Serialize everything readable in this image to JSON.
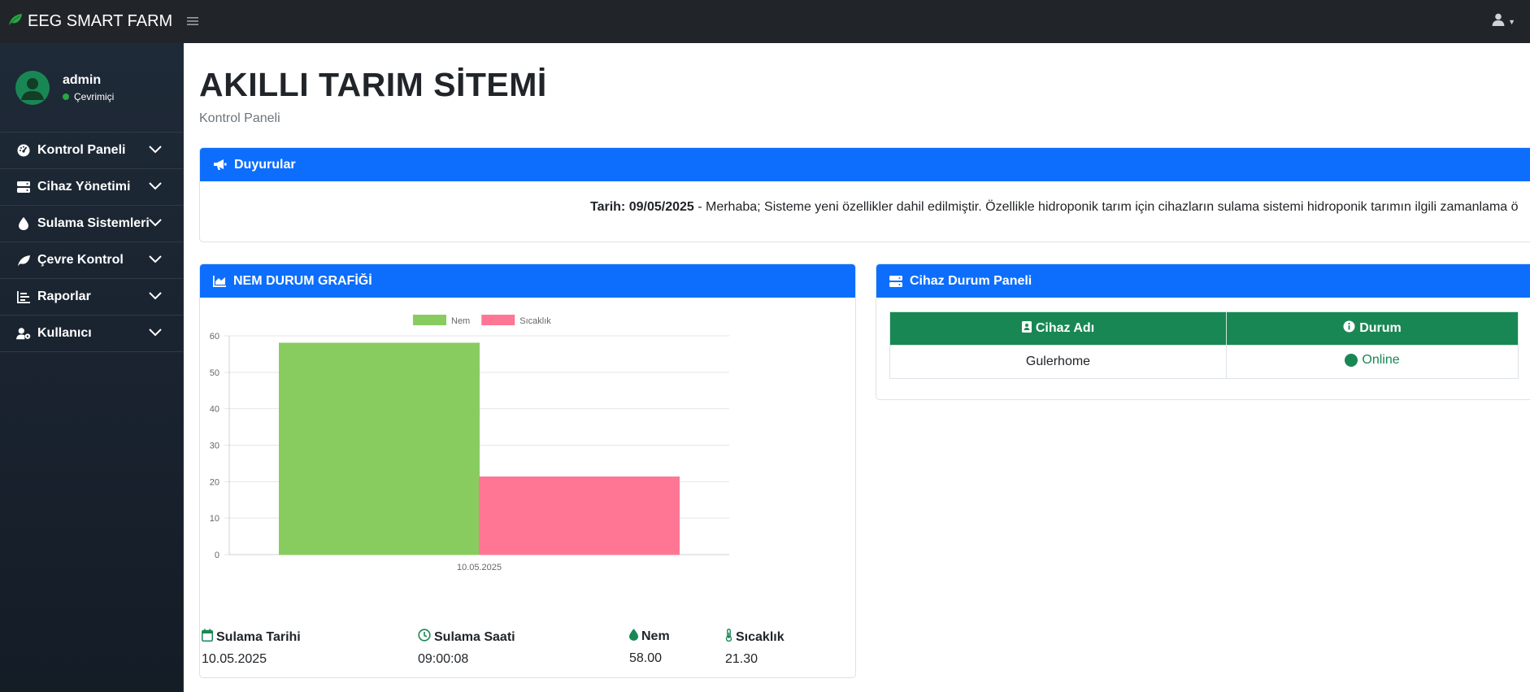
{
  "brand": {
    "title": "EEG SMART FARM",
    "icon": "leaf-icon",
    "color": "#28a745"
  },
  "topbar": {
    "menu_icon": "bars-icon",
    "user_icon": "user-icon"
  },
  "sidebar": {
    "user": {
      "name": "admin",
      "status": "Çevrimiçi"
    },
    "items": [
      {
        "label": "Kontrol Paneli",
        "icon": "tachometer-icon"
      },
      {
        "label": "Cihaz Yönetimi",
        "icon": "server-icon"
      },
      {
        "label": "Sulama Sistemleri",
        "icon": "droplet-icon"
      },
      {
        "label": "Çevre Kontrol",
        "icon": "leaf-icon"
      },
      {
        "label": "Raporlar",
        "icon": "chart-bar-icon"
      },
      {
        "label": "Kullanıcı",
        "icon": "user-cog-icon"
      }
    ]
  },
  "page": {
    "title": "AKILLI TARIM SİTEMİ",
    "subtitle": "Kontrol Paneli"
  },
  "announcements": {
    "header": "Duyurular",
    "date_label": "Tarih: 09/05/2025",
    "text": " - Merhaba; Sisteme yeni özellikler dahil edilmiştir. Özellikle hidroponik tarım için cihazların sulama sistemi hidroponik tarımın ilgili zamanlama ö"
  },
  "chart_card": {
    "header": "NEM DURUM GRAFİĞİ",
    "stats": [
      {
        "label": "Sulama Tarihi",
        "value": "10.05.2025",
        "icon": "calendar-icon"
      },
      {
        "label": "Sulama Saati",
        "value": "09:00:08",
        "icon": "clock-icon"
      },
      {
        "label": "Nem",
        "value": "58.00",
        "icon": "droplet-icon"
      },
      {
        "label": "Sıcaklık",
        "value": "21.30",
        "icon": "thermometer-icon"
      }
    ]
  },
  "chart_data": {
    "type": "bar",
    "categories": [
      "10.05.2025"
    ],
    "series": [
      {
        "name": "Nem",
        "values": [
          58.0
        ],
        "color": "#88cc5f"
      },
      {
        "name": "Sıcaklık",
        "values": [
          21.3
        ],
        "color": "#ff7694"
      }
    ],
    "ylim": [
      0,
      60
    ],
    "yticks": [
      0,
      10,
      20,
      30,
      40,
      50,
      60
    ],
    "grid": true,
    "legend": "top-center"
  },
  "device_card": {
    "header": "Cihaz Durum Paneli",
    "columns": [
      {
        "label": "Cihaz Adı",
        "icon": "id-card-icon"
      },
      {
        "label": "Durum",
        "icon": "info-circle-icon"
      }
    ],
    "rows": [
      {
        "name": "Gulerhome",
        "status": "Online",
        "status_color": "#198754"
      }
    ]
  }
}
